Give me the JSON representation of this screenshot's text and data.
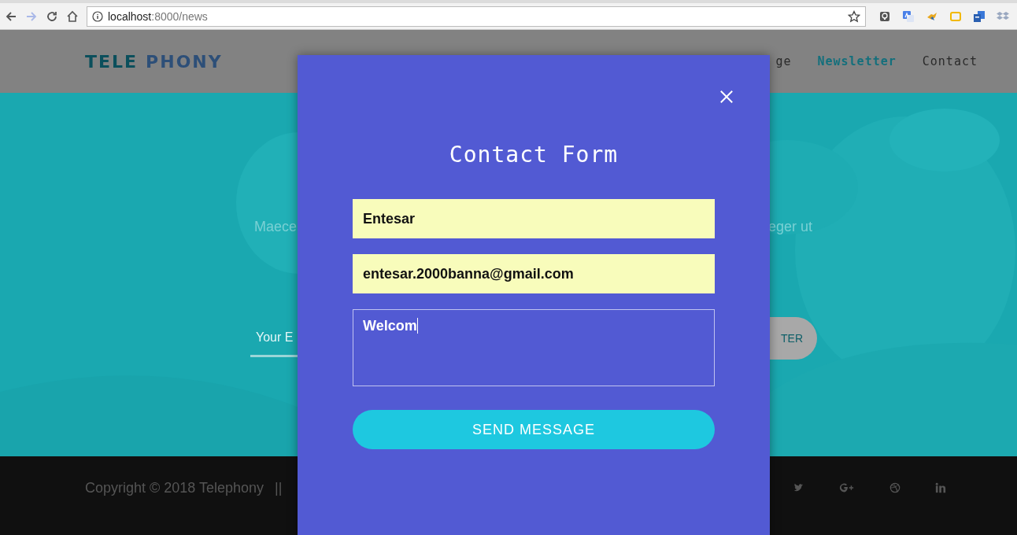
{
  "browser": {
    "forward_disabled": true,
    "address_host": "localhost",
    "address_path": ":8000/news"
  },
  "header": {
    "logo": [
      {
        "text": "TELE",
        "color": "#0b4f5c"
      },
      {
        "text": "PHONY",
        "color": "#2d4f78"
      }
    ],
    "nav": [
      {
        "label": "ge",
        "selected": false
      },
      {
        "label": "Newsletter",
        "selected": true
      },
      {
        "label": "Contact",
        "selected": false
      }
    ]
  },
  "hero": {
    "text_left": "Maece",
    "text_right": "eger ut",
    "email_placeholder": "Your E",
    "subscribe_button": "TER"
  },
  "footer": {
    "copyright": "Copyright © 2018 Telephony",
    "separator": "||"
  },
  "modal": {
    "title": "Contact Form",
    "fields": [
      {
        "kind": "input",
        "value": "Entesar",
        "focused": false
      },
      {
        "kind": "input",
        "value": "entesar.2000banna@gmail.com",
        "focused": false
      },
      {
        "kind": "textarea",
        "value": "Welcom",
        "focused": true
      }
    ],
    "submit": "SEND MESSAGE"
  }
}
